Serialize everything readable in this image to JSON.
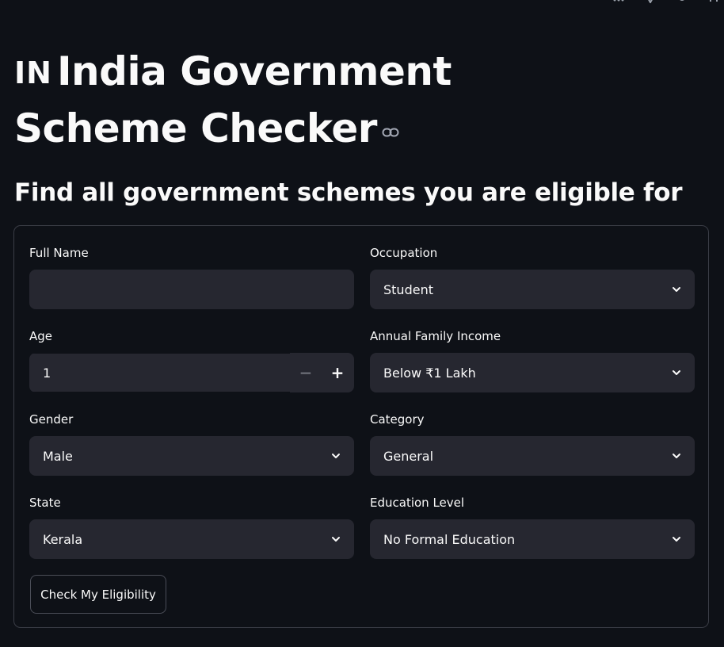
{
  "header": {
    "flag": "IN",
    "title": "India Government Scheme Checker",
    "subtitle": "Find all government schemes you are eligible for"
  },
  "form": {
    "full_name": {
      "label": "Full Name",
      "value": ""
    },
    "occupation": {
      "label": "Occupation",
      "value": "Student"
    },
    "age": {
      "label": "Age",
      "value": "1",
      "decrement": "−",
      "increment": "+"
    },
    "income": {
      "label": "Annual Family Income",
      "value": "Below ₹1 Lakh"
    },
    "gender": {
      "label": "Gender",
      "value": "Male"
    },
    "category": {
      "label": "Category",
      "value": "General"
    },
    "state": {
      "label": "State",
      "value": "Kerala"
    },
    "education": {
      "label": "Education Level",
      "value": "No Formal Education"
    },
    "submit_label": "Check My Eligibility"
  },
  "icons": {
    "title_link": "link-icon",
    "dropdown": "chevron-down-icon"
  }
}
